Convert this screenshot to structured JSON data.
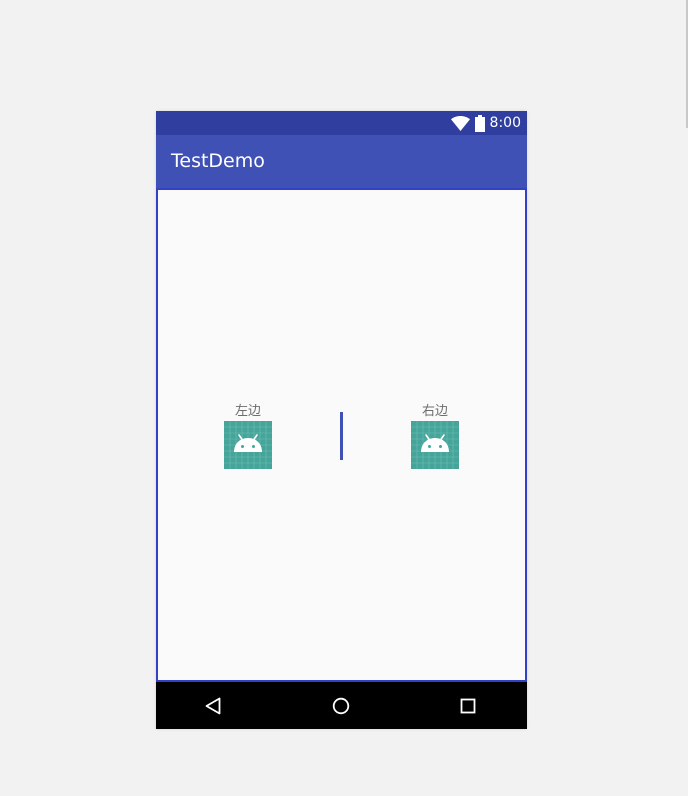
{
  "status_bar": {
    "time": "8:00",
    "icons": [
      "wifi-icon",
      "battery-icon"
    ]
  },
  "app_bar": {
    "title": "TestDemo"
  },
  "content": {
    "left_item": {
      "label": "左边",
      "icon": "android-launcher-icon"
    },
    "right_item": {
      "label": "右边",
      "icon": "android-launcher-icon"
    },
    "divider": "vertical-divider"
  },
  "nav_bar": {
    "buttons": [
      "back-icon",
      "home-icon",
      "recents-icon"
    ]
  },
  "colors": {
    "status_bar": "#303f9f",
    "app_bar": "#3f51b5",
    "content_border": "#3342c4",
    "launcher_bg": "#45a59a",
    "nav_bar": "#000000"
  }
}
